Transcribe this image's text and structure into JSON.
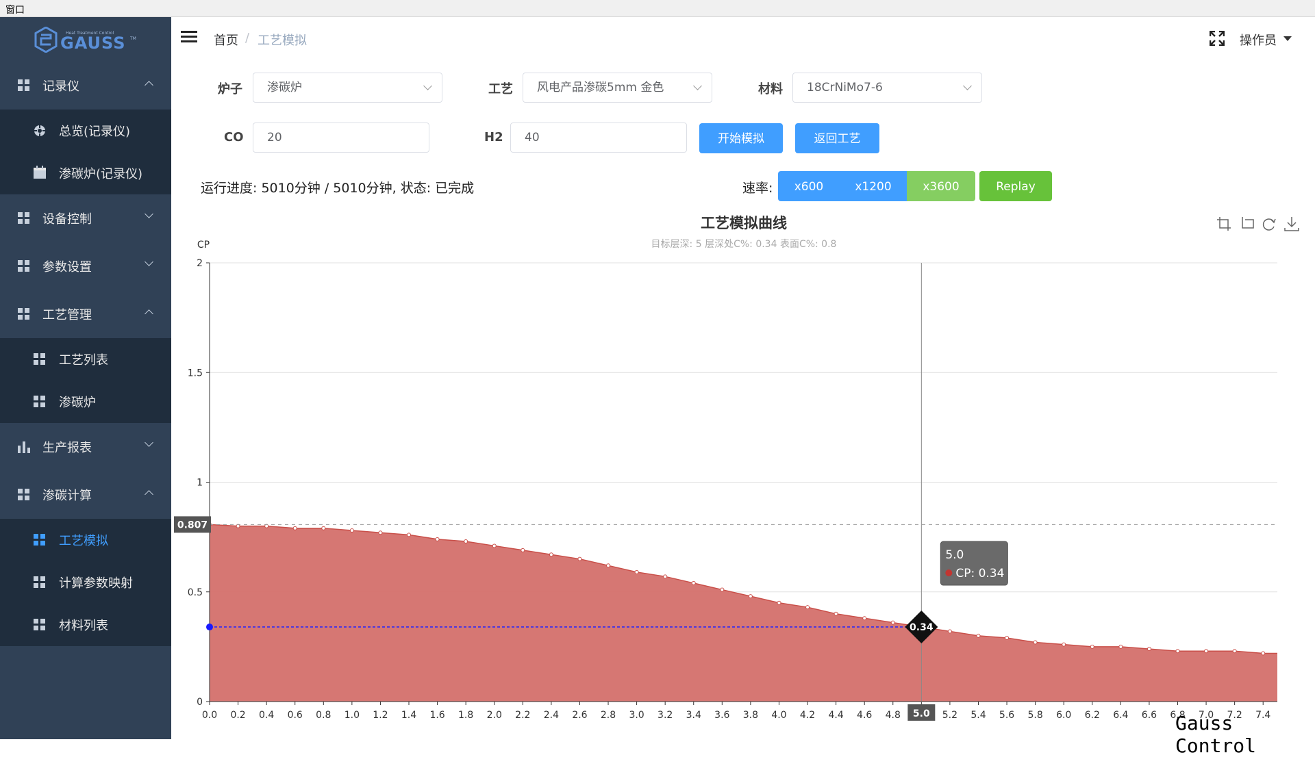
{
  "window": {
    "title": "窗口"
  },
  "logo": {
    "brand": "GAUSS",
    "tagline": "Heat Treatment Control",
    "tm": "TM"
  },
  "sidebar": {
    "groups": [
      {
        "label": "记录仪",
        "icon": "grid-icon",
        "expanded": true,
        "items": [
          {
            "label": "总览(记录仪)",
            "icon": "circle-icon"
          },
          {
            "label": "渗碳炉(记录仪)",
            "icon": "calendar-icon"
          }
        ]
      },
      {
        "label": "设备控制",
        "icon": "grid-icon",
        "expanded": false
      },
      {
        "label": "参数设置",
        "icon": "grid-icon",
        "expanded": false
      },
      {
        "label": "工艺管理",
        "icon": "grid-icon",
        "expanded": true,
        "items": [
          {
            "label": "工艺列表",
            "icon": "grid-icon"
          },
          {
            "label": "渗碳炉",
            "icon": "grid-icon"
          }
        ]
      },
      {
        "label": "生产报表",
        "icon": "bar-chart-icon",
        "expanded": false
      },
      {
        "label": "渗碳计算",
        "icon": "grid-icon",
        "expanded": true,
        "items": [
          {
            "label": "工艺模拟",
            "icon": "grid-icon",
            "active": true
          },
          {
            "label": "计算参数映射",
            "icon": "grid-icon"
          },
          {
            "label": "材料列表",
            "icon": "grid-icon"
          }
        ]
      }
    ]
  },
  "breadcrumb": {
    "home": "首页",
    "sep": "/",
    "current": "工艺模拟"
  },
  "header": {
    "user": "操作员"
  },
  "form": {
    "furnace_label": "炉子",
    "furnace_value": "渗碳炉",
    "process_label": "工艺",
    "process_value": "风电产品渗碳5mm 金色",
    "material_label": "材料",
    "material_value": "18CrNiMo7-6",
    "co_label": "CO",
    "co_value": "20",
    "h2_label": "H2",
    "h2_value": "40",
    "start_button": "开始模拟",
    "back_button": "返回工艺"
  },
  "status": {
    "progress_text": "运行进度: 5010分钟 / 5010分钟, 状态: 已完成",
    "rate_label": "速率:"
  },
  "speed_buttons": [
    "x600",
    "x1200",
    "x3600"
  ],
  "replay_button": "Replay",
  "watermark": "Gauss Control",
  "colors": {
    "sidebar_bg": "#304156",
    "submenu_bg": "#1f2d3d",
    "accent": "#409eff",
    "green": "#67c23a",
    "area": "#d4706b"
  },
  "chart_data": {
    "type": "area",
    "title": "工艺模拟曲线",
    "subtitle": "目标层深: 5   层深处C%: 0.34   表面C%: 0.8",
    "ylabel": "CP",
    "xlabel": "",
    "ylim": [
      0,
      2
    ],
    "yticks": [
      0,
      0.5,
      1,
      1.5,
      2
    ],
    "xlim": [
      0,
      7.5
    ],
    "xtick_step": 0.2,
    "grid": true,
    "x": [
      0.0,
      0.2,
      0.4,
      0.6,
      0.8,
      1.0,
      1.2,
      1.4,
      1.6,
      1.8,
      2.0,
      2.2,
      2.4,
      2.6,
      2.8,
      3.0,
      3.2,
      3.4,
      3.6,
      3.8,
      4.0,
      4.2,
      4.4,
      4.6,
      4.8,
      5.0,
      5.2,
      5.4,
      5.6,
      5.8,
      6.0,
      6.2,
      6.4,
      6.6,
      6.8,
      7.0,
      7.2,
      7.4,
      7.5
    ],
    "values": [
      0.807,
      0.8,
      0.8,
      0.79,
      0.79,
      0.78,
      0.77,
      0.76,
      0.74,
      0.73,
      0.71,
      0.69,
      0.67,
      0.65,
      0.62,
      0.59,
      0.57,
      0.54,
      0.51,
      0.48,
      0.45,
      0.43,
      0.4,
      0.38,
      0.36,
      0.34,
      0.32,
      0.3,
      0.29,
      0.27,
      0.26,
      0.25,
      0.25,
      0.24,
      0.23,
      0.23,
      0.23,
      0.22,
      0.22
    ],
    "markline_y": 0.807,
    "markline_label": "0.807",
    "crosshair": {
      "x_label": "5.0",
      "y": 0.34,
      "point_label": "0.34"
    },
    "tooltip": {
      "title": "5.0",
      "series": "CP",
      "value": "0.34",
      "line": "CP: 0.34"
    },
    "toolbox": [
      "zoom-icon",
      "zoom-reset-icon",
      "restore-icon",
      "download-icon"
    ]
  }
}
